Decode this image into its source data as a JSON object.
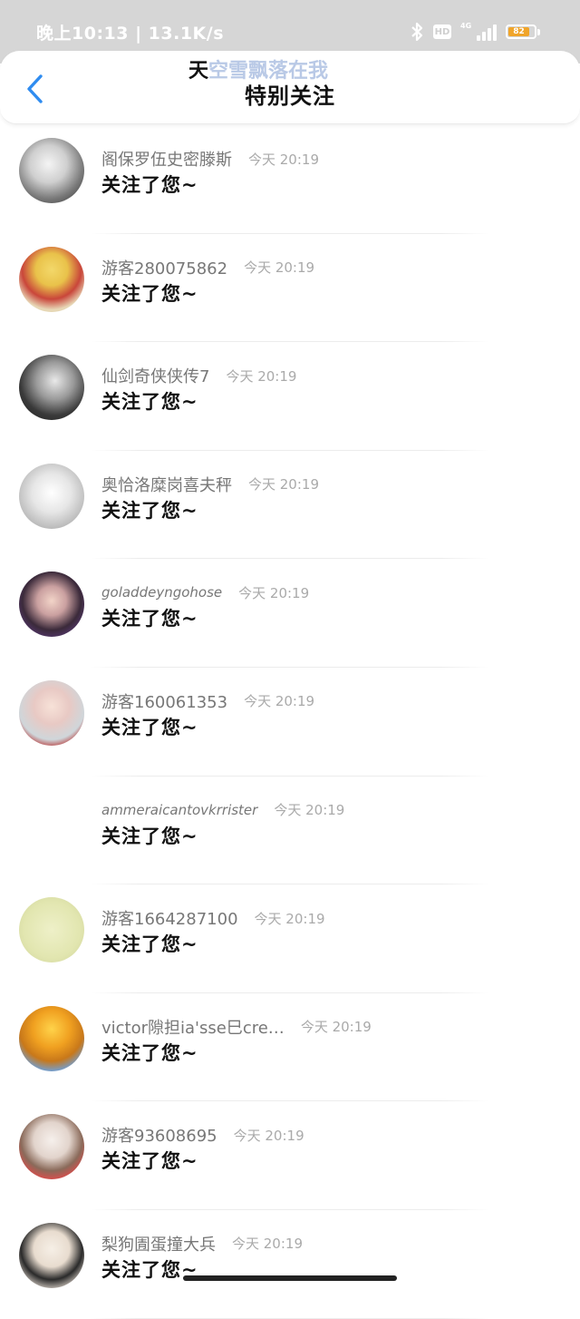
{
  "status_bar": {
    "time": "晚上10:13",
    "speed": "13.1K/s",
    "hd": "HD",
    "network": "4G",
    "battery": "82",
    "battery_level": 0.82,
    "battery_color": "#f0a52a"
  },
  "header": {
    "title": "特别关注",
    "ticker_dark": "天",
    "ticker_ghost": "空雪飘落在我"
  },
  "notifications": [
    {
      "name": "阁保罗伍史密滕斯",
      "time": "今天 20:19",
      "action": "关注了您~",
      "avatar": "a1"
    },
    {
      "name": "游客280075862",
      "time": "今天 20:19",
      "action": "关注了您~",
      "avatar": "a2"
    },
    {
      "name": "仙剑奇侠侠传7",
      "time": "今天 20:19",
      "action": "关注了您~",
      "avatar": "a3"
    },
    {
      "name": "奥恰洛糜岗喜夫秤",
      "time": "今天 20:19",
      "action": "关注了您~",
      "avatar": "a4"
    },
    {
      "name": "goladdeyngohose",
      "time": "今天 20:19",
      "action": "关注了您~",
      "avatar": "a5"
    },
    {
      "name": "游客160061353",
      "time": "今天 20:19",
      "action": "关注了您~",
      "avatar": "a6"
    },
    {
      "name": "ammeraicantovkrrister",
      "time": "今天 20:19",
      "action": "关注了您~",
      "avatar": "none"
    },
    {
      "name": "游客1664287100",
      "time": "今天 20:19",
      "action": "关注了您~",
      "avatar": "a8"
    },
    {
      "name": "victor隙担ia'sse巳cre…",
      "time": "今天 20:19",
      "action": "关注了您~",
      "avatar": "a9"
    },
    {
      "name": "游客93608695",
      "time": "今天 20:19",
      "action": "关注了您~",
      "avatar": "a10"
    },
    {
      "name": "梨狗圊蛋撞大兵",
      "time": "今天 20:19",
      "action": "关注了您~",
      "avatar": "a11"
    }
  ]
}
